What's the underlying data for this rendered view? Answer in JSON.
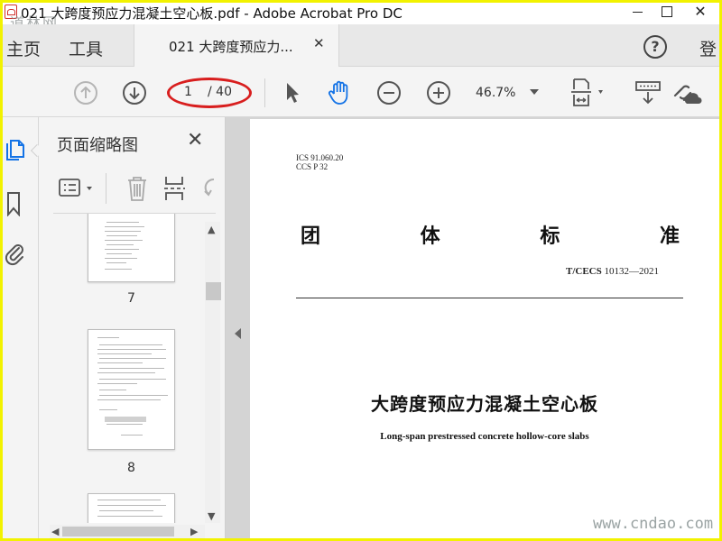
{
  "window": {
    "title": "021 大跨度预应力混凝土空心板.pdf - Adobe Acrobat Pro DC",
    "close_glyph": "✕"
  },
  "watermarks": {
    "top_left": "道林网",
    "bottom_right": "www.cndao.com"
  },
  "tabbar": {
    "home": "主页",
    "tools": "工具",
    "doc_tab_label": "021 大跨度预应力...",
    "doc_tab_close": "✕",
    "help": "?",
    "signin": "登"
  },
  "toolbar": {
    "current_page": "1",
    "total_pages": "/ 40",
    "zoom": "46.7%",
    "highlight_color": "#d81e1e",
    "icons": [
      "up-circle-icon",
      "down-circle-icon",
      "arrow-pointer-icon",
      "hand-icon",
      "zoom-out-icon",
      "zoom-in-icon",
      "fit-page-icon",
      "scroll-mode-icon",
      "share-link-icon"
    ]
  },
  "panel": {
    "title": "页面缩略图",
    "close": "✕",
    "thumbnails": [
      {
        "page": "7"
      },
      {
        "page": "8"
      }
    ]
  },
  "document": {
    "ics_line1": "ICS  91.060.20",
    "ics_line2": "CCS  P  32",
    "standard_type": [
      "团",
      "体",
      "标",
      "准"
    ],
    "standard_no_prefix": "T/CECS",
    "standard_no": " 10132—2021",
    "title_cn": "大跨度预应力混凝土空心板",
    "title_en": "Long-span prestressed concrete hollow-core slabs"
  },
  "colors": {
    "border": "#f2f200",
    "accent_blue": "#1473e6"
  }
}
